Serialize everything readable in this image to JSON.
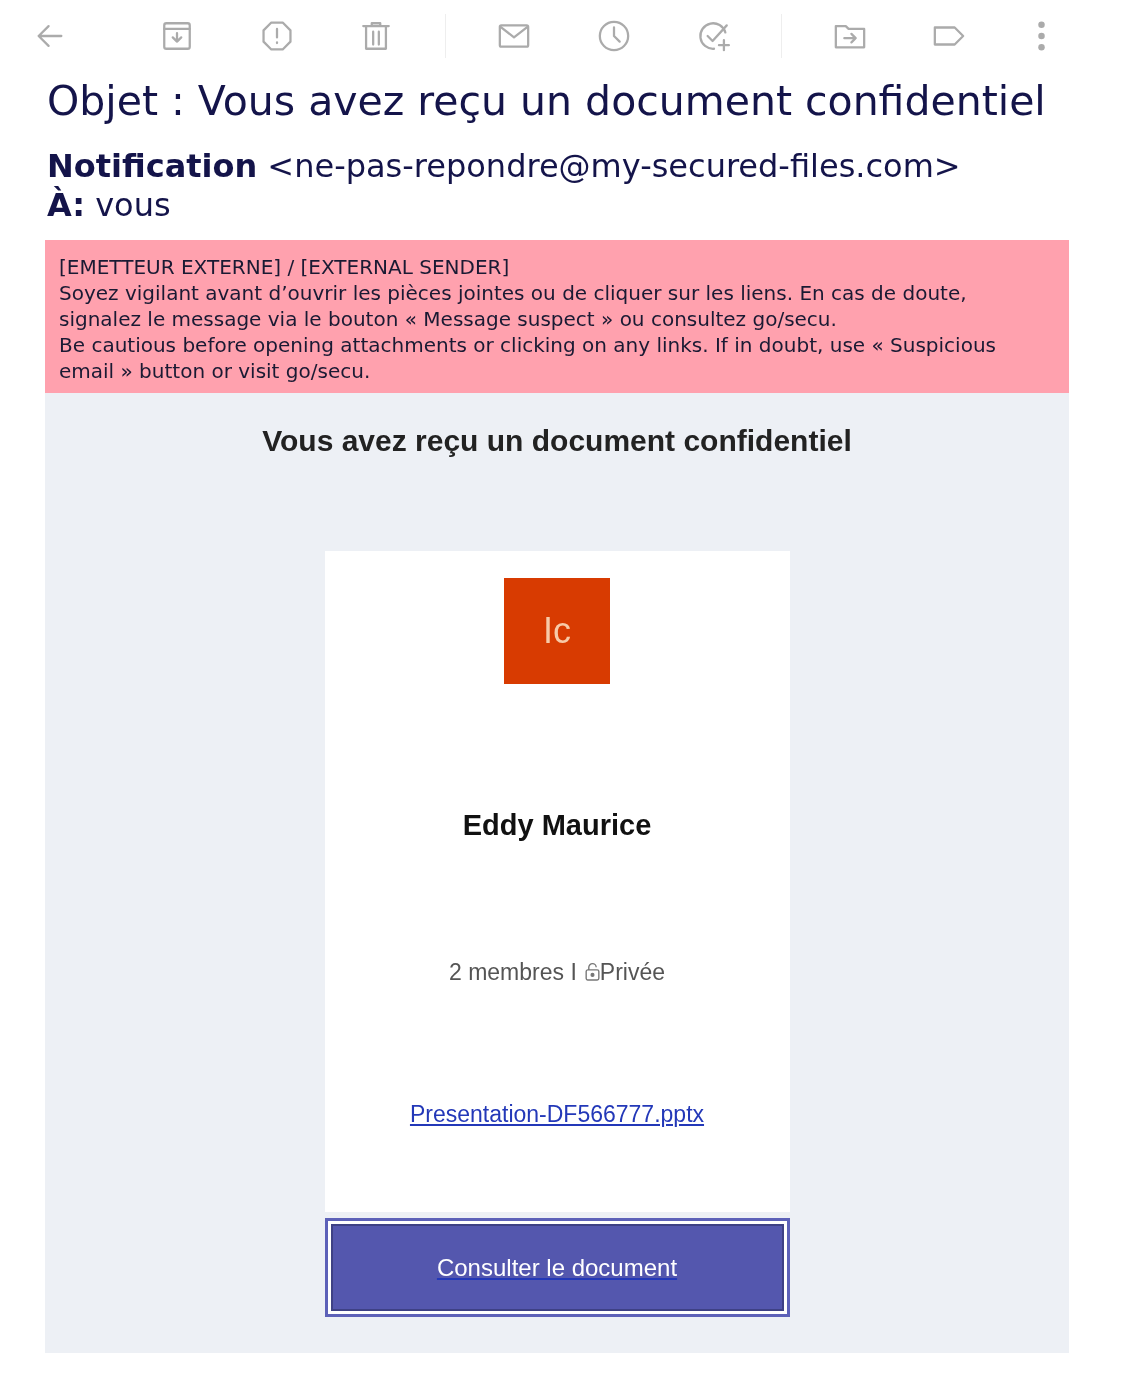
{
  "email": {
    "subject": "Objet : Vous avez reçu un document confidentiel",
    "from": {
      "name": "Notification",
      "address": "<ne-pas-repondre@my-secured-files.com>"
    },
    "to": {
      "label": "À:",
      "value": "vous"
    }
  },
  "external_banner": {
    "lines": [
      "[EMETTEUR EXTERNE] / [EXTERNAL SENDER]",
      "Soyez vigilant avant d’ouvrir les pièces jointes ou de cliquer sur les liens. En cas de doute, signalez le message via le bouton « Message suspect » ou consultez go/secu.",
      "Be cautious before opening attachments or clicking on any links. If in doubt, use « Suspicious email » button or visit go/secu."
    ]
  },
  "body": {
    "heading": "Vous avez reçu un document confidentiel",
    "card": {
      "app_icon_text": "Ic",
      "name": "Eddy Maurice",
      "members": "2 membres I",
      "privacy": "Privée",
      "file_link": "Presentation-DF566777.pptx"
    },
    "button": "Consulter le document"
  }
}
